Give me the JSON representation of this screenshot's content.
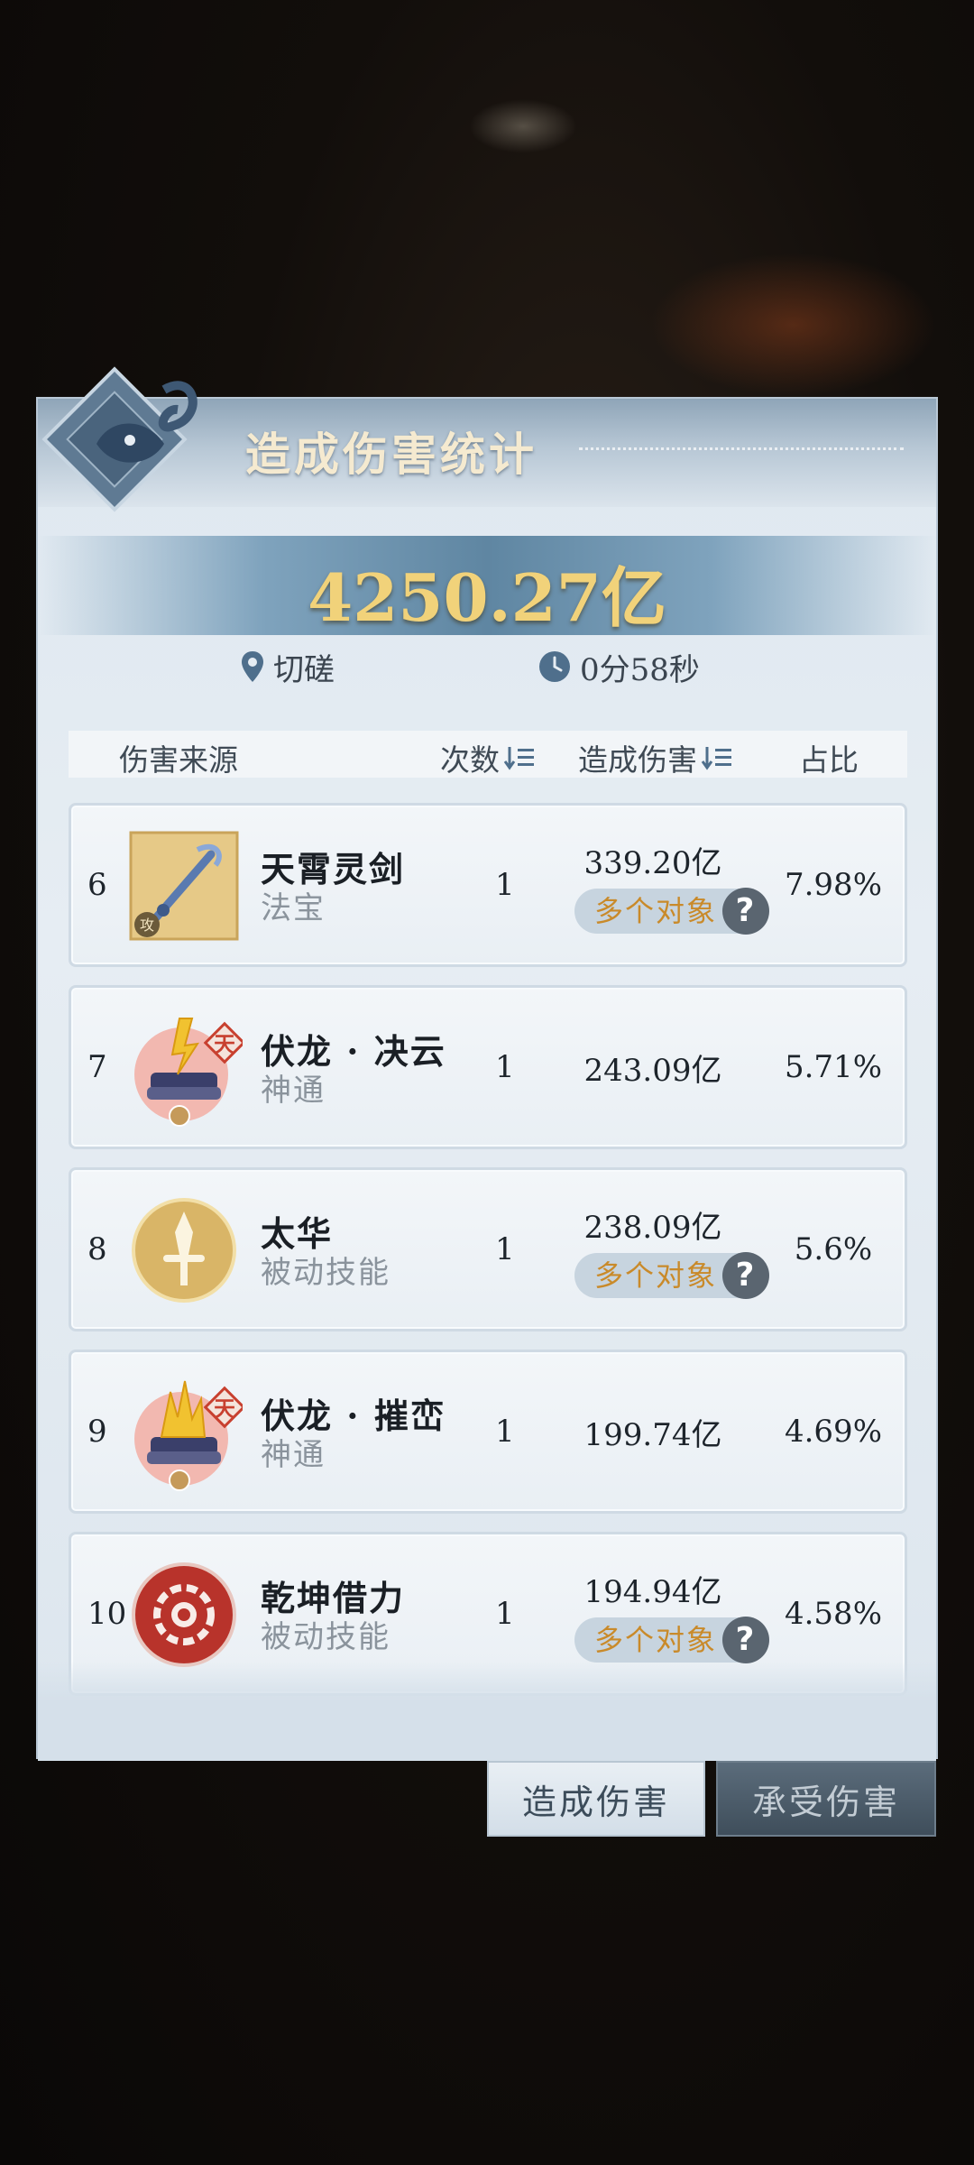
{
  "panel": {
    "title": "造成伤害统计",
    "total_damage": "4250.27亿",
    "location": "切磋",
    "duration": "0分58秒"
  },
  "table": {
    "headers": {
      "source": "伤害来源",
      "count": "次数",
      "damage": "造成伤害",
      "ratio": "占比"
    },
    "rows": [
      {
        "rank": "6",
        "name": "天霄灵剑",
        "type": "法宝",
        "count": "1",
        "damage": "339.20亿",
        "multi_target": "多个对象",
        "ratio": "7.98%",
        "icon": "sword-treasure-icon"
      },
      {
        "rank": "7",
        "name": "伏龙 · 决云",
        "type": "神通",
        "count": "1",
        "damage": "243.09亿",
        "multi_target": "",
        "ratio": "5.71%",
        "icon": "scroll-lightning-icon"
      },
      {
        "rank": "8",
        "name": "太华",
        "type": "被动技能",
        "count": "1",
        "damage": "238.09亿",
        "multi_target": "多个对象",
        "ratio": "5.6%",
        "icon": "gold-sword-emblem-icon"
      },
      {
        "rank": "9",
        "name": "伏龙 · 摧峦",
        "type": "神通",
        "count": "1",
        "damage": "199.74亿",
        "multi_target": "",
        "ratio": "4.69%",
        "icon": "scroll-flame-icon"
      },
      {
        "rank": "10",
        "name": "乾坤借力",
        "type": "被动技能",
        "count": "1",
        "damage": "194.94亿",
        "multi_target": "多个对象",
        "ratio": "4.58%",
        "icon": "red-gear-emblem-icon"
      }
    ],
    "help_glyph": "?"
  },
  "tabs": {
    "deal": "造成伤害",
    "take": "承受伤害"
  },
  "badges": {
    "heaven": "天",
    "attack": "攻"
  },
  "colors": {
    "gold_text": "#f1d27a",
    "orange_text": "#c98a2a",
    "panel_bg": "#e6edf3"
  }
}
